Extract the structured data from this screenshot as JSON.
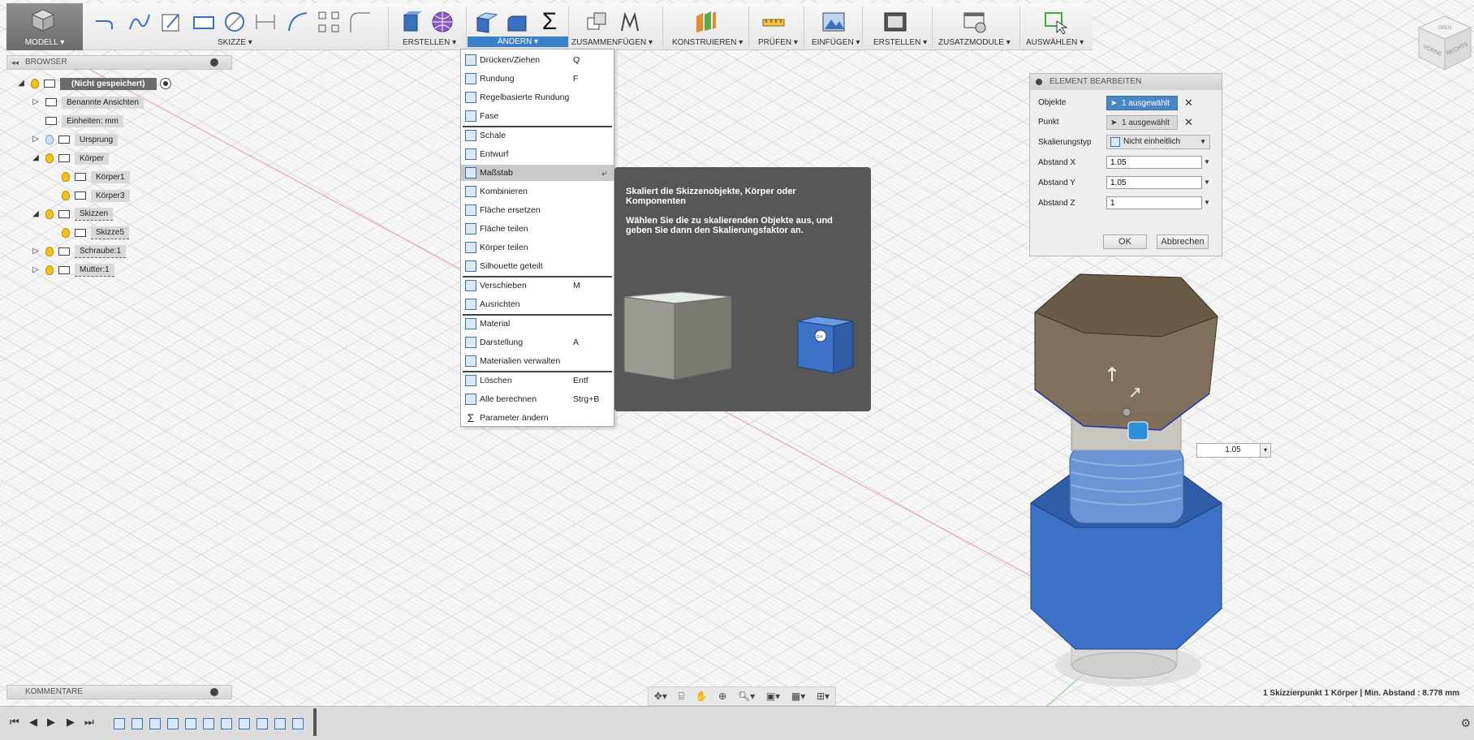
{
  "toolbar": {
    "model_label": "MODELL ▾",
    "groups": {
      "skizze": "SKIZZE ▾",
      "erstellen": "ERSTELLEN ▾",
      "aendern": "ÄNDERN ▾",
      "zusammenfuegen": "ZUSAMMENFÜGEN ▾",
      "konstruieren": "KONSTRUIEREN ▾",
      "pruefen": "PRÜFEN ▾",
      "einfuegen": "EINFÜGEN ▾",
      "erstellen2": "ERSTELLEN ▾",
      "zusatzmodule": "ZUSATZMODULE ▾",
      "auswaehlen": "AUSWÄHLEN ▾"
    },
    "sigma": "Σ",
    "active_color": "#3b7fc9"
  },
  "browser": {
    "title": "BROWSER",
    "items": [
      {
        "label": "(Nicht gespeichert)"
      },
      {
        "label": "Benannte Ansichten"
      },
      {
        "label": "Einheiten: mm"
      },
      {
        "label": "Ursprung"
      },
      {
        "label": "Körper"
      },
      {
        "label": "Körper1"
      },
      {
        "label": "Körper3"
      },
      {
        "label": "Skizzen"
      },
      {
        "label": "Skizze5"
      },
      {
        "label": "Schraube:1"
      },
      {
        "label": "Mutter:1"
      }
    ]
  },
  "menu": {
    "items": [
      {
        "label": "Drücken/Ziehen",
        "shortcut": "Q"
      },
      {
        "label": "Rundung",
        "shortcut": "F"
      },
      {
        "label": "Regelbasierte Rundung",
        "shortcut": ""
      },
      {
        "label": "Fase",
        "shortcut": ""
      },
      {
        "label": "Schale",
        "shortcut": ""
      },
      {
        "label": "Entwurf",
        "shortcut": ""
      },
      {
        "label": "Maßstab",
        "shortcut": ""
      },
      {
        "label": "Kombinieren",
        "shortcut": ""
      },
      {
        "label": "Fläche ersetzen",
        "shortcut": ""
      },
      {
        "label": "Fläche teilen",
        "shortcut": ""
      },
      {
        "label": "Körper teilen",
        "shortcut": ""
      },
      {
        "label": "Silhouette geteilt",
        "shortcut": ""
      },
      {
        "label": "Verschieben",
        "shortcut": "M"
      },
      {
        "label": "Ausrichten",
        "shortcut": ""
      },
      {
        "label": "Material",
        "shortcut": ""
      },
      {
        "label": "Darstellung",
        "shortcut": "A"
      },
      {
        "label": "Materialien verwalten",
        "shortcut": ""
      },
      {
        "label": "Löschen",
        "shortcut": "Entf"
      },
      {
        "label": "Alle berechnen",
        "shortcut": "Strg+B"
      },
      {
        "label": "Parameter ändern",
        "shortcut": ""
      }
    ],
    "highlighted": "Maßstab"
  },
  "tooltip": {
    "title": "Skaliert die Skizzenobjekte, Körper oder Komponenten",
    "body": "Wählen Sie die zu skalierenden Objekte aus, und geben Sie dann den Skalierungsfaktor an."
  },
  "dialog": {
    "title": "ELEMENT BEARBEITEN",
    "objekte_label": "Objekte",
    "objekte_value": "1 ausgewählt",
    "punkt_label": "Punkt",
    "punkt_value": "1 ausgewählt",
    "skalierungstyp_label": "Skalierungstyp",
    "skalierungstyp_value": "Nicht einheitlich",
    "abstand_x_label": "Abstand X",
    "abstand_x_value": "1.05",
    "abstand_y_label": "Abstand Y",
    "abstand_y_value": "1.05",
    "abstand_z_label": "Abstand Z",
    "abstand_z_value": "1",
    "ok_label": "OK",
    "cancel_label": "Abbrechen"
  },
  "float_input": {
    "value": "1.05"
  },
  "comments": {
    "title": "KOMMENTARE"
  },
  "status": {
    "text": "1 Skizzierpunkt 1 Körper | Min. Abstand : 8.778 mm"
  },
  "viewcube": {
    "top": "OBEN",
    "front": "VORNE",
    "right": "RECHTS"
  },
  "colors": {
    "nut_blue": "#3d72c9",
    "bolt_brown": "#7a6a55",
    "axis_red": "#e08080"
  }
}
